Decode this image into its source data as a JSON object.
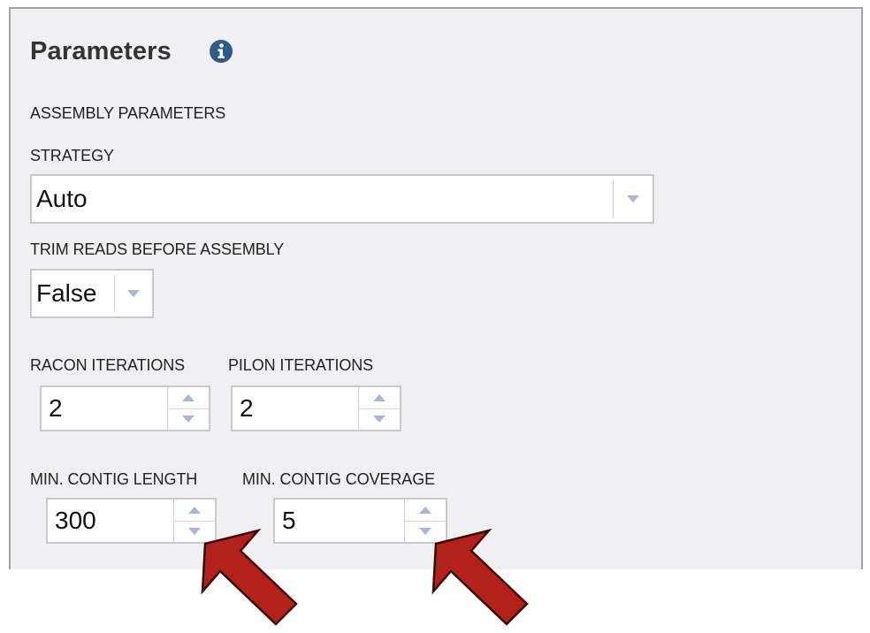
{
  "header": {
    "title": "Parameters"
  },
  "icons": {
    "info": "info-circle-icon",
    "dropdown": "triangle-down-icon",
    "increment": "triangle-up-icon",
    "decrement": "triangle-down-icon",
    "annotation": "red-arrow-icon"
  },
  "colors": {
    "info_icon": "#2e5b87",
    "spinner_arrow": "#a8b8d4",
    "annotation_arrow": "#b3211b",
    "panel_bg": "#f0f0f2"
  },
  "section": {
    "label": "ASSEMBLY PARAMETERS"
  },
  "strategy": {
    "label": "STRATEGY",
    "value": "Auto"
  },
  "trim_reads": {
    "label": "TRIM READS BEFORE ASSEMBLY",
    "value": "False"
  },
  "racon": {
    "label": "RACON ITERATIONS",
    "value": "2"
  },
  "pilon": {
    "label": "PILON ITERATIONS",
    "value": "2"
  },
  "min_contig_length": {
    "label": "MIN. CONTIG LENGTH",
    "value": "300"
  },
  "min_contig_coverage": {
    "label": "MIN. CONTIG COVERAGE",
    "value": "5"
  }
}
